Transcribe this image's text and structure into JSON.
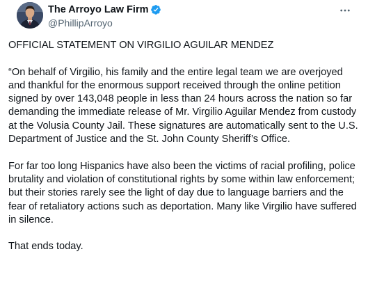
{
  "author": {
    "display_name": "The Arroyo Law Firm",
    "handle": "@PhillipArroyo",
    "verified": true,
    "verified_color": "#1d9bf0"
  },
  "icons": {
    "avatar": "avatar",
    "verified": "verified-badge-icon",
    "more": "more-options-icon"
  },
  "tweet": {
    "paragraphs": [
      "OFFICIAL STATEMENT ON VIRGILIO AGUILAR MENDEZ",
      "“On behalf of Virgilio, his family and the entire legal team we are overjoyed and thankful for the enormous support received through the online petition signed by over 143,048 people in less than 24 hours across the nation so far demanding the immediate release of Mr. Virgilio Aguilar Mendez from custody at the Volusia County Jail. These signatures are automatically sent to the U.S. Department of Justice and the St. John County Sheriff’s Office.",
      "For far too long Hispanics have also been the victims of racial profiling, police brutality and violation of constitutional rights by some within law enforcement; but their stories rarely see the light of day due to language barriers and the fear of retaliatory actions such as deportation. Many like Virgilio have suffered in silence.",
      "That ends today."
    ]
  }
}
